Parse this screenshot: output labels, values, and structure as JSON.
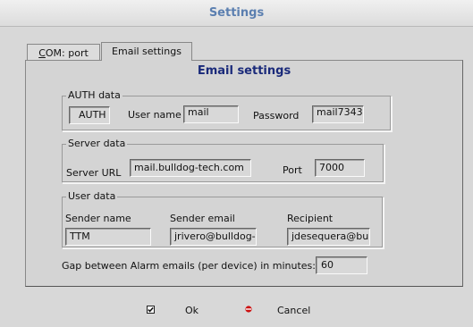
{
  "window": {
    "title": "Settings"
  },
  "tabs": [
    {
      "label_prefix": "C",
      "label_rest": "OM: port"
    },
    {
      "label": "Email settings"
    }
  ],
  "panel": {
    "heading": "Email settings"
  },
  "auth": {
    "legend": "AUTH data",
    "auth_value": "AUTH",
    "username_label": "User name",
    "username_value": "mail",
    "password_label": "Password",
    "password_value": "mail7343"
  },
  "server": {
    "legend": "Server data",
    "url_label": "Server URL",
    "url_value": "mail.bulldog-tech.com",
    "port_label": "Port",
    "port_value": "7000"
  },
  "user": {
    "legend": "User data",
    "sender_name_label": "Sender name",
    "sender_name_value": "TTM",
    "sender_email_label": "Sender email",
    "sender_email_value": "jrivero@bulldog-t",
    "recipient_label": "Recipient",
    "recipient_value": "jdesequera@bull"
  },
  "gap": {
    "label": "Gap between Alarm emails (per device) in minutes:",
    "value": "60"
  },
  "buttons": {
    "ok_label": "Ok",
    "cancel_label": "Cancel",
    "ok_icon": "checkbox-icon",
    "cancel_icon": "red-dot-icon"
  },
  "colors": {
    "title": "#5b7fb0",
    "heading": "#1a2a7a",
    "cancel_icon": "#cc1111"
  }
}
